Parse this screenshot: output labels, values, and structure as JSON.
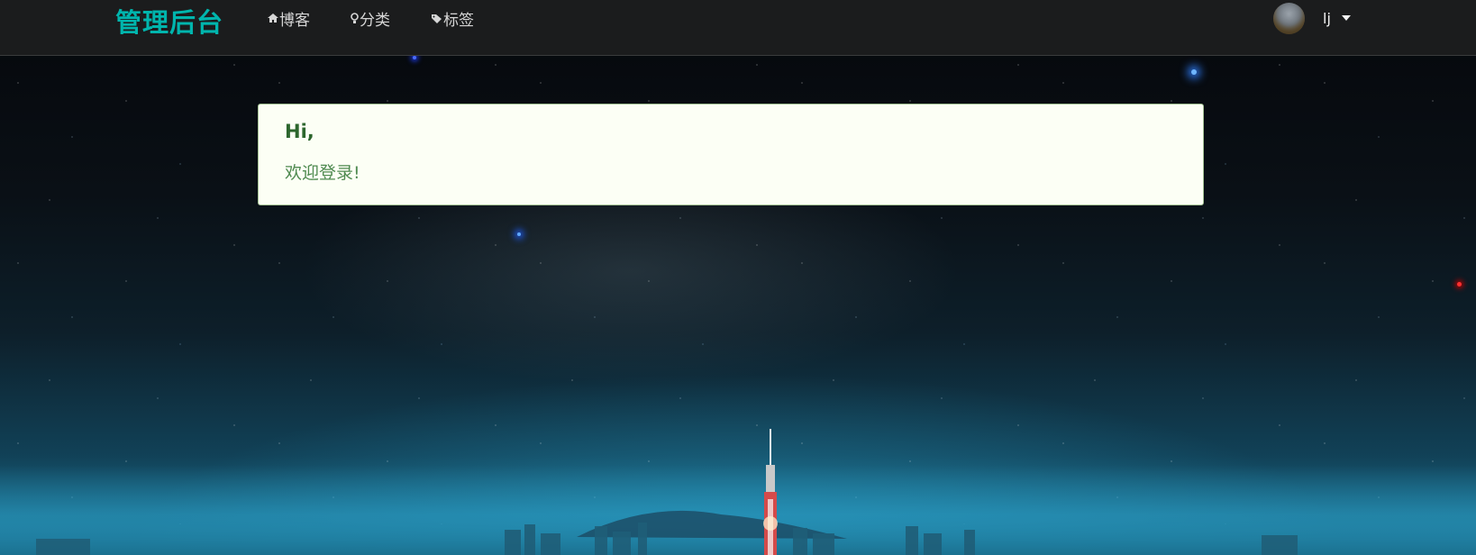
{
  "navbar": {
    "brand": "管理后台",
    "items": [
      {
        "label": "博客",
        "icon": "home-icon"
      },
      {
        "label": "分类",
        "icon": "idea-icon"
      },
      {
        "label": "标签",
        "icon": "tags-icon"
      }
    ],
    "user": {
      "name": "lj",
      "avatar_icon": "user-avatar",
      "menu_icon": "caret-down-icon"
    }
  },
  "message": {
    "header": "Hi,",
    "body": "欢迎登录!"
  },
  "colors": {
    "brand": "#00b5ad",
    "navbar_bg": "#1b1c1d",
    "message_bg": "#fcfff5",
    "message_border": "#a3c293",
    "message_header": "#2c662d",
    "message_text": "#4f8a50"
  }
}
